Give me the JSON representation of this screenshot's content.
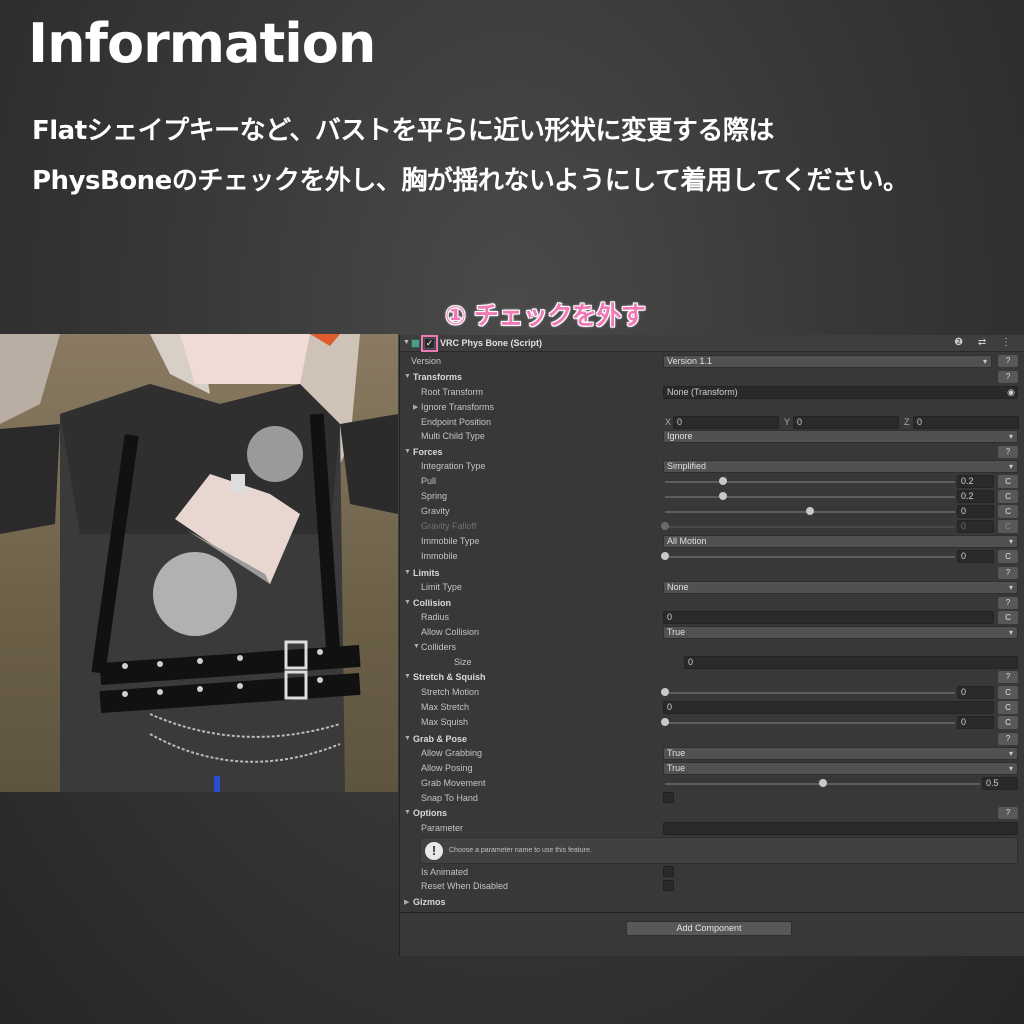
{
  "title": "Information",
  "description": {
    "line1": "Flatシェイプキーなど、バストを平らに近い形状に変更する際は",
    "line2": "PhysBoneのチェックを外し、胸が揺れないようにして着用してください。"
  },
  "callout": "① チェックを外す",
  "colors": {
    "accent": "#f07ab5",
    "panel": "#383838",
    "field": "#2a2a2a"
  },
  "inspector": {
    "component_name": "VRC Phys Bone (Script)",
    "enabled_check": "✓",
    "header_icons": "❷ ⇄ ⋮",
    "version_label": "Version",
    "version_value": "Version 1.1",
    "help_q": "?",
    "sections": {
      "transforms": "Transforms",
      "forces": "Forces",
      "limits": "Limits",
      "collision": "Collision",
      "stretch": "Stretch & Squish",
      "grab": "Grab & Pose",
      "options": "Options",
      "gizmos": "Gizmos"
    },
    "root_transform": {
      "label": "Root Transform",
      "value": "None (Transform)"
    },
    "ignore_transforms": "Ignore Transforms",
    "endpoint": {
      "label": "Endpoint Position",
      "x_label": "X",
      "x": "0",
      "y_label": "Y",
      "y": "0",
      "z_label": "Z",
      "z": "0"
    },
    "multi_child": {
      "label": "Multi Child Type",
      "value": "Ignore"
    },
    "integration": {
      "label": "Integration Type",
      "value": "Simplified"
    },
    "pull": {
      "label": "Pull",
      "value": "0.2",
      "fraction": 0.2
    },
    "spring": {
      "label": "Spring",
      "value": "0.2",
      "fraction": 0.2
    },
    "gravity": {
      "label": "Gravity",
      "value": "0",
      "fraction": 0.5
    },
    "gravity_falloff": {
      "label": "Gravity Falloff",
      "value": "0",
      "fraction": 0
    },
    "immobile_type": {
      "label": "Immobile Type",
      "value": "All Motion"
    },
    "immobile": {
      "label": "Immobile",
      "value": "0",
      "fraction": 0
    },
    "limit_type": {
      "label": "Limit Type",
      "value": "None"
    },
    "radius": {
      "label": "Radius",
      "value": "0"
    },
    "allow_collision": {
      "label": "Allow Collision",
      "value": "True"
    },
    "colliders": "Colliders",
    "size": {
      "label": "Size",
      "value": "0"
    },
    "stretch_motion": {
      "label": "Stretch Motion",
      "value": "0",
      "fraction": 0
    },
    "max_stretch": {
      "label": "Max Stretch",
      "value": "0"
    },
    "max_squish": {
      "label": "Max Squish",
      "value": "0",
      "fraction": 0
    },
    "allow_grabbing": {
      "label": "Allow Grabbing",
      "value": "True"
    },
    "allow_posing": {
      "label": "Allow Posing",
      "value": "True"
    },
    "grab_movement": {
      "label": "Grab Movement",
      "value": "0.5",
      "fraction": 0.5
    },
    "snap_to_hand": "Snap To Hand",
    "parameter": "Parameter",
    "help_text": "Choose a parameter name to use this feature.",
    "help_icon": "!",
    "is_animated": "Is Animated",
    "reset_when_disabled": "Reset When Disabled",
    "c_label": "C",
    "add_component": "Add Component"
  }
}
